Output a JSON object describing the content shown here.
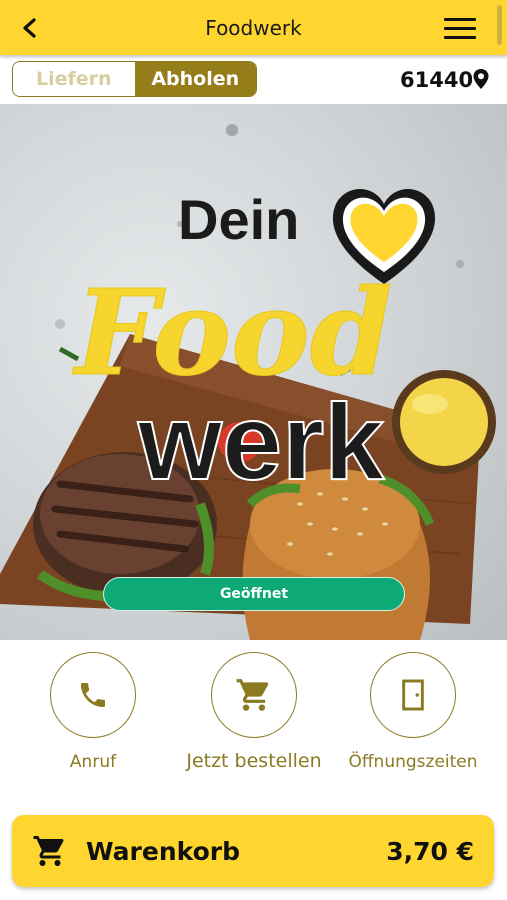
{
  "header": {
    "title": "Foodwerk",
    "back_icon": "chevron-left-icon",
    "menu_icon": "hamburger-menu-icon",
    "background": "#fed62f"
  },
  "mode": {
    "options": [
      "Liefern",
      "Abholen"
    ],
    "selected": "Abholen"
  },
  "location": {
    "zip": "61440",
    "icon": "map-pin-icon"
  },
  "hero": {
    "logo_text": [
      "Dein",
      "Food",
      "werk"
    ],
    "status_label": "Geöffnet",
    "status_color": "#0daa78"
  },
  "actions": [
    {
      "label": "Anruf",
      "icon": "phone-icon"
    },
    {
      "label": "Jetzt bestellen",
      "icon": "shopping-cart-icon"
    },
    {
      "label": "Öffnungszeiten",
      "icon": "door-icon"
    }
  ],
  "cart": {
    "label": "Warenkorb",
    "total": "3,70 €",
    "icon": "shopping-cart-icon"
  },
  "colors": {
    "accent": "#fed62f",
    "gold": "#957d1a",
    "open_green": "#0daa78"
  }
}
